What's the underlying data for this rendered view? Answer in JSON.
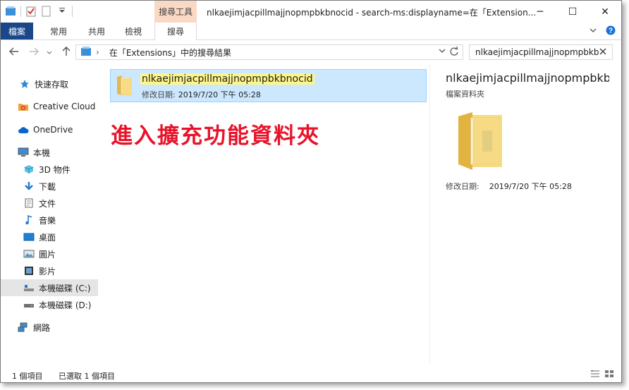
{
  "titlebar": {
    "tool_tab": "搜尋工具",
    "title": "nlkaejimjacpillmajjnopmpbkbnocid - search-ms:displayname=在「Extension...",
    "minimize": "─",
    "maximize": "☐",
    "close": "✕"
  },
  "ribbon": {
    "tabs": [
      "檔案",
      "常用",
      "共用",
      "檢視",
      "搜尋"
    ],
    "active_tab": "搜尋"
  },
  "address": {
    "path": "在「Extensions」中的搜尋結果",
    "separator": "›"
  },
  "search": {
    "value": "nlkaejimjacpillmajjnopmpbkb"
  },
  "navpane": {
    "items": [
      {
        "label": "快速存取",
        "icon": "star-icon"
      },
      {
        "label": "Creative Cloud F",
        "icon": "creative-cloud-icon"
      },
      {
        "label": "OneDrive",
        "icon": "cloud-icon"
      },
      {
        "label": "本機",
        "icon": "computer-icon"
      },
      {
        "label": "3D 物件",
        "icon": "cube-icon"
      },
      {
        "label": "下載",
        "icon": "download-icon"
      },
      {
        "label": "文件",
        "icon": "document-icon"
      },
      {
        "label": "音樂",
        "icon": "music-icon"
      },
      {
        "label": "桌面",
        "icon": "desktop-icon"
      },
      {
        "label": "圖片",
        "icon": "pictures-icon"
      },
      {
        "label": "影片",
        "icon": "video-icon"
      },
      {
        "label": "本機磁碟 (C:)",
        "icon": "drive-c-icon"
      },
      {
        "label": "本機磁碟 (D:)",
        "icon": "drive-d-icon"
      },
      {
        "label": "網路",
        "icon": "network-icon"
      }
    ],
    "selected": "本機磁碟 (C:)"
  },
  "result": {
    "name": "nlkaejimjacpillmajjnopmpbkbnocid",
    "meta_label": "修改日期:",
    "meta_value": "2019/7/20 下午 05:28"
  },
  "annotation": "進入擴充功能資料夾",
  "preview": {
    "title": "nlkaejimjacpillmajjnopmpbkb...",
    "type": "檔案資料夾",
    "meta_label": "修改日期:",
    "meta_value": "2019/7/20 下午 05:28"
  },
  "statusbar": {
    "count": "1 個項目",
    "selected": "已選取 1 個項目"
  },
  "colors": {
    "file_tab": "#19478a",
    "tool_tab": "#f9d9c4",
    "selection": "#cce8ff",
    "highlight": "#fdf58a",
    "annotation": "#e8132a"
  }
}
